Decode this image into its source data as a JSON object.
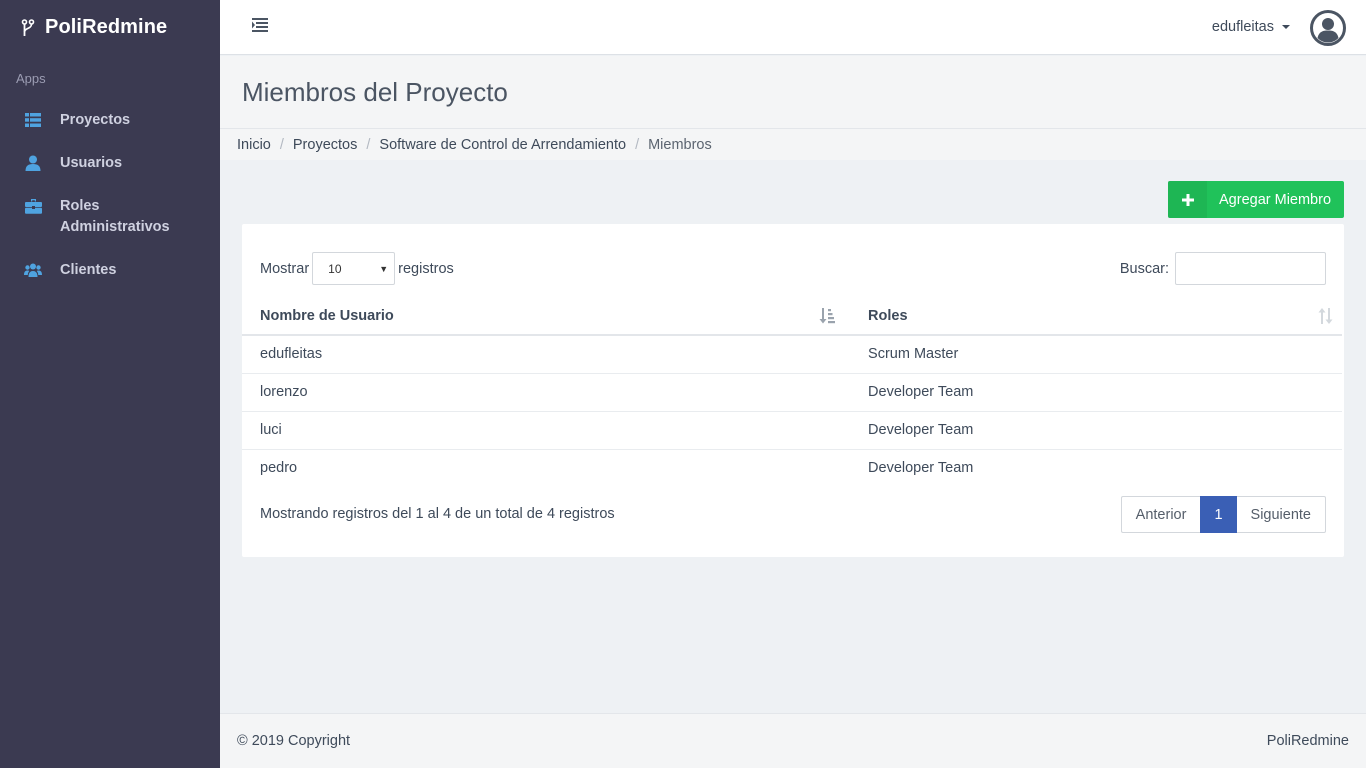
{
  "brand": {
    "name": "PoliRedmine",
    "icon": "code-branch-icon"
  },
  "sidebar": {
    "section_label": "Apps",
    "items": [
      {
        "label": "Proyectos",
        "icon": "list-icon"
      },
      {
        "label": "Usuarios",
        "icon": "user-icon"
      },
      {
        "label": "Roles Administrativos",
        "icon": "briefcase-icon"
      },
      {
        "label": "Clientes",
        "icon": "users-icon"
      }
    ]
  },
  "topbar": {
    "username": "edufleitas",
    "toggle_icon": "menu-toggle-icon",
    "avatar_icon": "user-circle-icon"
  },
  "page": {
    "title": "Miembros del Proyecto"
  },
  "breadcrumb": [
    "Inicio",
    "Proyectos",
    "Software de Control de Arrendamiento",
    "Miembros"
  ],
  "actions": {
    "add_member": "Agregar Miembro"
  },
  "table_controls": {
    "show_label": "Mostrar",
    "page_length": "10",
    "records_label": "registros",
    "search_label": "Buscar:",
    "search_value": ""
  },
  "table": {
    "columns": [
      "Nombre de Usuario",
      "Roles"
    ],
    "rows": [
      [
        "edufleitas",
        "Scrum Master"
      ],
      [
        "lorenzo",
        "Developer Team"
      ],
      [
        "luci",
        "Developer Team"
      ],
      [
        "pedro",
        "Developer Team"
      ]
    ]
  },
  "footer_info": "Mostrando registros del 1 al 4 de un total de 4 registros",
  "pagination": {
    "prev": "Anterior",
    "current": "1",
    "next": "Siguiente"
  },
  "footer": {
    "copyright": "© 2019 Copyright",
    "brand": "PoliRedmine"
  },
  "colors": {
    "sidebar": "#3b3a51",
    "accent_blue": "#3a5fb5",
    "add_button": "#20c25a",
    "icon_blue": "#4fa3e0"
  }
}
